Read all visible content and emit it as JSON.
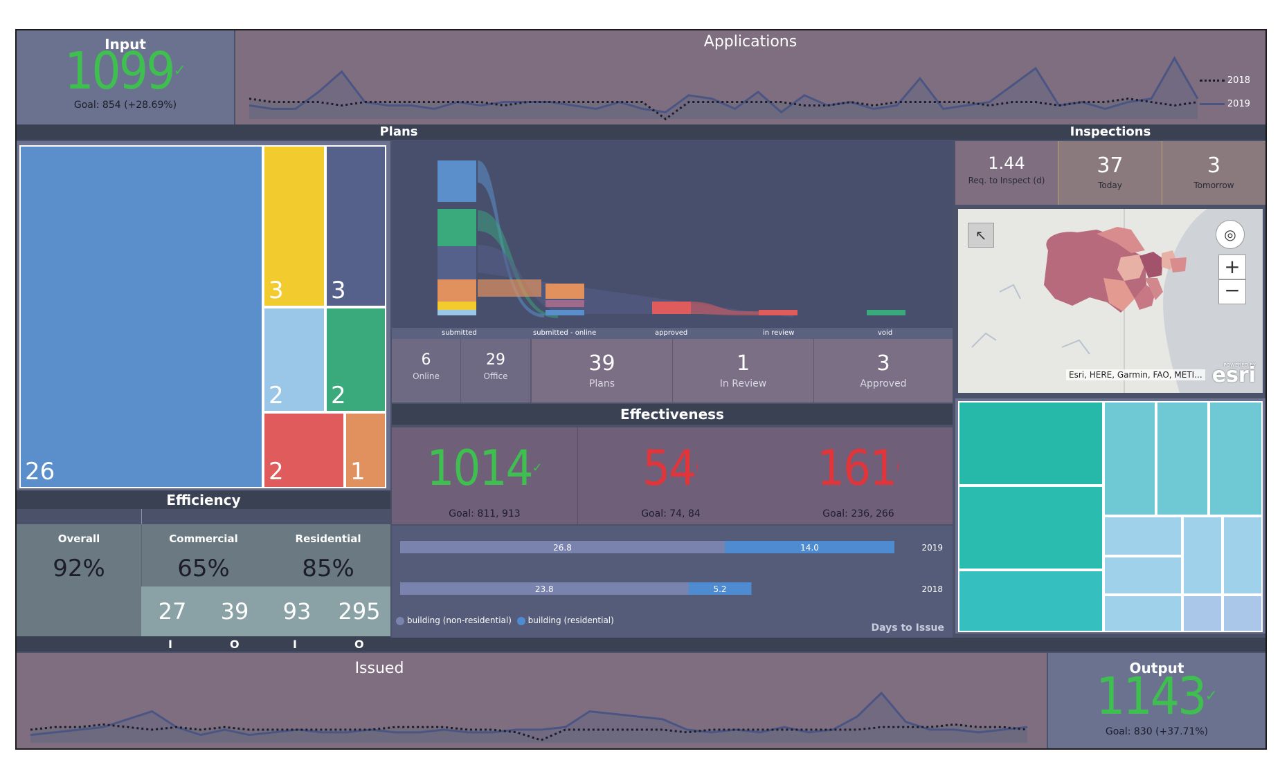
{
  "input": {
    "title": "Input",
    "value": "1099",
    "check": "✓",
    "goal": "Goal: 854 (+28.69%)"
  },
  "applications": {
    "title": "Applications",
    "legend": [
      "2018",
      "2019"
    ],
    "chart_data": {
      "type": "area",
      "series": [
        {
          "name": "2019",
          "values": [
            4,
            3,
            3,
            8,
            14,
            5,
            4,
            4,
            3,
            5,
            4,
            5,
            5,
            5,
            4,
            3,
            5,
            3,
            2,
            7,
            6,
            3,
            8,
            2,
            7,
            4,
            5,
            3,
            4,
            12,
            3,
            4,
            5,
            10,
            15,
            4,
            5,
            3,
            5,
            6,
            18,
            6
          ]
        },
        {
          "name": "2018",
          "values": [
            6,
            5,
            5,
            5,
            4,
            5,
            5,
            5,
            5,
            5,
            5,
            4,
            5,
            5,
            5,
            5,
            5,
            5,
            0,
            5,
            5,
            5,
            5,
            5,
            4,
            4,
            5,
            4,
            5,
            5,
            5,
            5,
            4,
            5,
            5,
            4,
            5,
            5,
            6,
            5,
            4,
            5
          ]
        }
      ]
    }
  },
  "plans": {
    "title": "Plans",
    "treemap": [
      {
        "label": "26",
        "color": "#5b8fcc"
      },
      {
        "label": "3",
        "color": "#f2cb2e"
      },
      {
        "label": "3",
        "color": "#55608b"
      },
      {
        "label": "2",
        "color": "#9ac7e8"
      },
      {
        "label": "2",
        "color": "#3aaa7d"
      },
      {
        "label": "2",
        "color": "#e05c5c"
      },
      {
        "label": "1",
        "color": "#e0915e"
      }
    ],
    "stages": [
      "submitted",
      "submitted - online",
      "approved",
      "in review",
      "void"
    ],
    "cards": [
      {
        "num": "6",
        "label": "Online"
      },
      {
        "num": "29",
        "label": "Office"
      },
      {
        "num": "39",
        "label": "Plans"
      },
      {
        "num": "1",
        "label": "In Review"
      },
      {
        "num": "3",
        "label": "Approved"
      }
    ]
  },
  "inspections": {
    "title": "Inspections",
    "cards": [
      {
        "num": "1.44",
        "label": "Req. to Inspect (d)"
      },
      {
        "num": "37",
        "label": "Today"
      },
      {
        "num": "3",
        "label": "Tomorrow"
      }
    ],
    "map_attribution": "Esri, HERE, Garmin, FAO, METI...",
    "map_logo_small": "POWERED BY",
    "map_logo": "esri"
  },
  "efficiency": {
    "title": "Efficiency",
    "overall_label": "Overall",
    "overall_value": "92%",
    "commercial_label": "Commercial",
    "commercial_value": "65%",
    "residential_label": "Residential",
    "residential_value": "85%",
    "counts": [
      "27",
      "39",
      "93",
      "295"
    ],
    "io": [
      "I",
      "O",
      "I",
      "O"
    ]
  },
  "effectiveness": {
    "title": "Effectiveness",
    "kpis": [
      {
        "value": "1014",
        "mark": "✓",
        "goal": "Goal: 811, 913",
        "color": "#3fbf4f"
      },
      {
        "value": "54",
        "mark": "!",
        "goal": "Goal: 74, 84",
        "color": "#e0353a"
      },
      {
        "value": "161",
        "mark": "!",
        "goal": "Goal: 236, 266",
        "color": "#e0353a"
      }
    ],
    "chart_data": {
      "type": "bar",
      "categories": [
        "2019",
        "2018"
      ],
      "series": [
        {
          "name": "building (non-residential)",
          "values": [
            26.8,
            23.8
          ],
          "color": "#7a83ad"
        },
        {
          "name": "building (residential)",
          "values": [
            14.0,
            5.2
          ],
          "color": "#4f8bd0"
        }
      ],
      "xlabel": "Days to Issue"
    }
  },
  "issued": {
    "title": "Issued",
    "chart_data": {
      "type": "area",
      "series": [
        {
          "name": "2019",
          "values": [
            3,
            4,
            5,
            6,
            9,
            12,
            6,
            3,
            5,
            3,
            4,
            5,
            4,
            4,
            5,
            4,
            4,
            5,
            4,
            4,
            5,
            5,
            6,
            12,
            11,
            10,
            9,
            5,
            4,
            5,
            4,
            6,
            4,
            5,
            10,
            19,
            8,
            5,
            5,
            4,
            5,
            6
          ]
        },
        {
          "name": "2018",
          "values": [
            5,
            6,
            6,
            7,
            6,
            5,
            6,
            5,
            6,
            5,
            5,
            5,
            5,
            5,
            5,
            6,
            6,
            6,
            5,
            5,
            4,
            1,
            5,
            5,
            5,
            5,
            5,
            4,
            5,
            5,
            5,
            5,
            5,
            5,
            5,
            6,
            6,
            6,
            7,
            6,
            6,
            5
          ]
        }
      ]
    }
  },
  "output": {
    "title": "Output",
    "value": "1143",
    "check": "✓",
    "goal": "Goal: 830 (+37.71%)"
  }
}
